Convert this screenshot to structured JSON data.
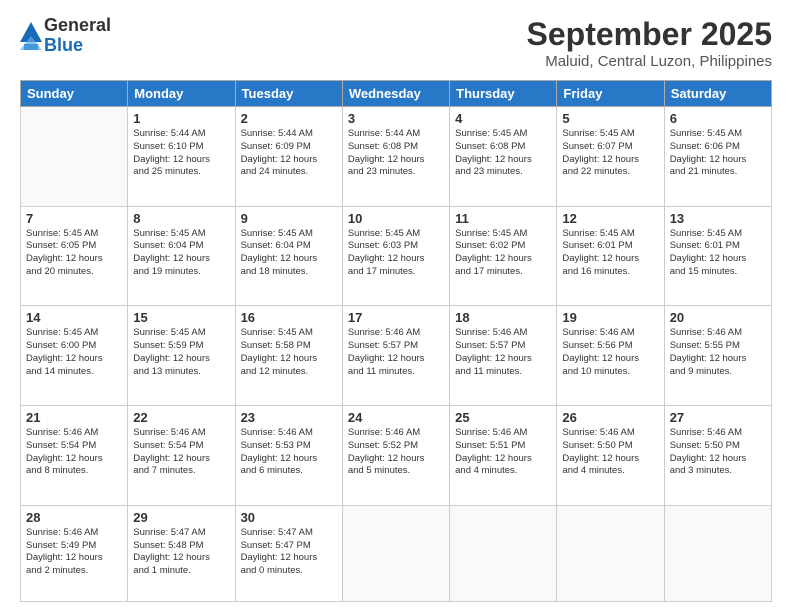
{
  "logo": {
    "general": "General",
    "blue": "Blue"
  },
  "header": {
    "month": "September 2025",
    "location": "Maluid, Central Luzon, Philippines"
  },
  "weekdays": [
    "Sunday",
    "Monday",
    "Tuesday",
    "Wednesday",
    "Thursday",
    "Friday",
    "Saturday"
  ],
  "weeks": [
    [
      {
        "day": "",
        "info": ""
      },
      {
        "day": "1",
        "info": "Sunrise: 5:44 AM\nSunset: 6:10 PM\nDaylight: 12 hours\nand 25 minutes."
      },
      {
        "day": "2",
        "info": "Sunrise: 5:44 AM\nSunset: 6:09 PM\nDaylight: 12 hours\nand 24 minutes."
      },
      {
        "day": "3",
        "info": "Sunrise: 5:44 AM\nSunset: 6:08 PM\nDaylight: 12 hours\nand 23 minutes."
      },
      {
        "day": "4",
        "info": "Sunrise: 5:45 AM\nSunset: 6:08 PM\nDaylight: 12 hours\nand 23 minutes."
      },
      {
        "day": "5",
        "info": "Sunrise: 5:45 AM\nSunset: 6:07 PM\nDaylight: 12 hours\nand 22 minutes."
      },
      {
        "day": "6",
        "info": "Sunrise: 5:45 AM\nSunset: 6:06 PM\nDaylight: 12 hours\nand 21 minutes."
      }
    ],
    [
      {
        "day": "7",
        "info": "Sunrise: 5:45 AM\nSunset: 6:05 PM\nDaylight: 12 hours\nand 20 minutes."
      },
      {
        "day": "8",
        "info": "Sunrise: 5:45 AM\nSunset: 6:04 PM\nDaylight: 12 hours\nand 19 minutes."
      },
      {
        "day": "9",
        "info": "Sunrise: 5:45 AM\nSunset: 6:04 PM\nDaylight: 12 hours\nand 18 minutes."
      },
      {
        "day": "10",
        "info": "Sunrise: 5:45 AM\nSunset: 6:03 PM\nDaylight: 12 hours\nand 17 minutes."
      },
      {
        "day": "11",
        "info": "Sunrise: 5:45 AM\nSunset: 6:02 PM\nDaylight: 12 hours\nand 17 minutes."
      },
      {
        "day": "12",
        "info": "Sunrise: 5:45 AM\nSunset: 6:01 PM\nDaylight: 12 hours\nand 16 minutes."
      },
      {
        "day": "13",
        "info": "Sunrise: 5:45 AM\nSunset: 6:01 PM\nDaylight: 12 hours\nand 15 minutes."
      }
    ],
    [
      {
        "day": "14",
        "info": "Sunrise: 5:45 AM\nSunset: 6:00 PM\nDaylight: 12 hours\nand 14 minutes."
      },
      {
        "day": "15",
        "info": "Sunrise: 5:45 AM\nSunset: 5:59 PM\nDaylight: 12 hours\nand 13 minutes."
      },
      {
        "day": "16",
        "info": "Sunrise: 5:45 AM\nSunset: 5:58 PM\nDaylight: 12 hours\nand 12 minutes."
      },
      {
        "day": "17",
        "info": "Sunrise: 5:46 AM\nSunset: 5:57 PM\nDaylight: 12 hours\nand 11 minutes."
      },
      {
        "day": "18",
        "info": "Sunrise: 5:46 AM\nSunset: 5:57 PM\nDaylight: 12 hours\nand 11 minutes."
      },
      {
        "day": "19",
        "info": "Sunrise: 5:46 AM\nSunset: 5:56 PM\nDaylight: 12 hours\nand 10 minutes."
      },
      {
        "day": "20",
        "info": "Sunrise: 5:46 AM\nSunset: 5:55 PM\nDaylight: 12 hours\nand 9 minutes."
      }
    ],
    [
      {
        "day": "21",
        "info": "Sunrise: 5:46 AM\nSunset: 5:54 PM\nDaylight: 12 hours\nand 8 minutes."
      },
      {
        "day": "22",
        "info": "Sunrise: 5:46 AM\nSunset: 5:54 PM\nDaylight: 12 hours\nand 7 minutes."
      },
      {
        "day": "23",
        "info": "Sunrise: 5:46 AM\nSunset: 5:53 PM\nDaylight: 12 hours\nand 6 minutes."
      },
      {
        "day": "24",
        "info": "Sunrise: 5:46 AM\nSunset: 5:52 PM\nDaylight: 12 hours\nand 5 minutes."
      },
      {
        "day": "25",
        "info": "Sunrise: 5:46 AM\nSunset: 5:51 PM\nDaylight: 12 hours\nand 4 minutes."
      },
      {
        "day": "26",
        "info": "Sunrise: 5:46 AM\nSunset: 5:50 PM\nDaylight: 12 hours\nand 4 minutes."
      },
      {
        "day": "27",
        "info": "Sunrise: 5:46 AM\nSunset: 5:50 PM\nDaylight: 12 hours\nand 3 minutes."
      }
    ],
    [
      {
        "day": "28",
        "info": "Sunrise: 5:46 AM\nSunset: 5:49 PM\nDaylight: 12 hours\nand 2 minutes."
      },
      {
        "day": "29",
        "info": "Sunrise: 5:47 AM\nSunset: 5:48 PM\nDaylight: 12 hours\nand 1 minute."
      },
      {
        "day": "30",
        "info": "Sunrise: 5:47 AM\nSunset: 5:47 PM\nDaylight: 12 hours\nand 0 minutes."
      },
      {
        "day": "",
        "info": ""
      },
      {
        "day": "",
        "info": ""
      },
      {
        "day": "",
        "info": ""
      },
      {
        "day": "",
        "info": ""
      }
    ]
  ]
}
